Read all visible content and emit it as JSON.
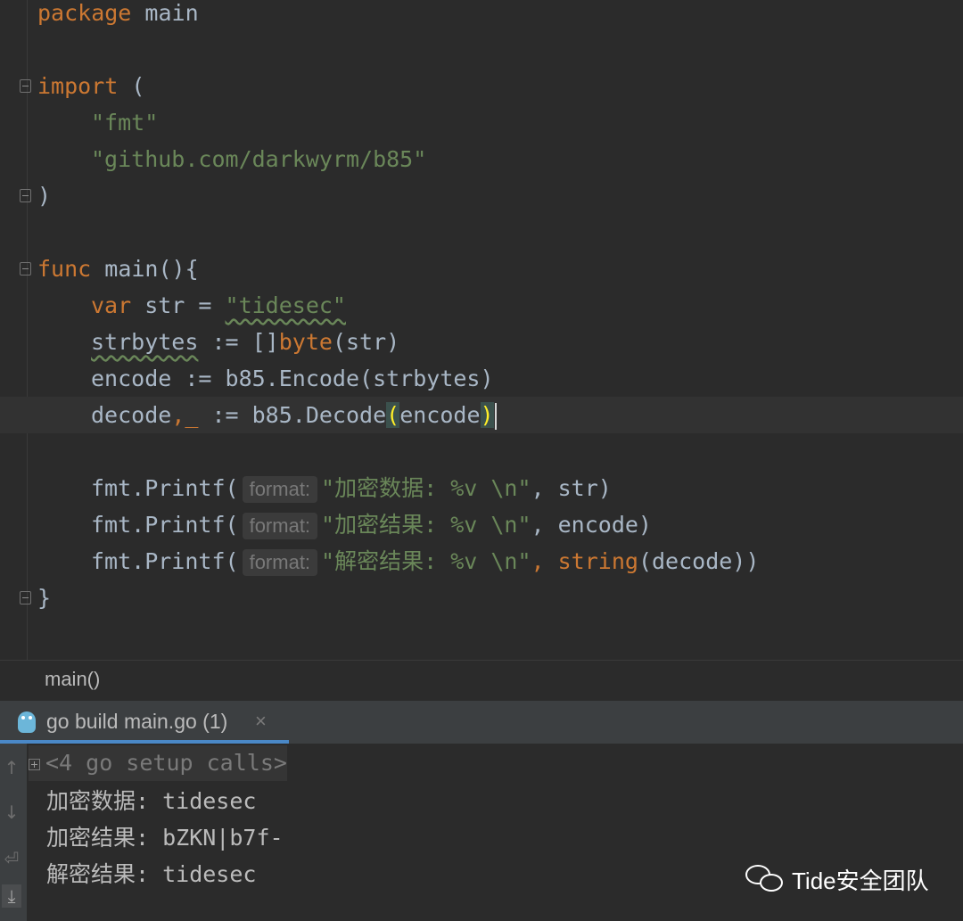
{
  "editor": {
    "lines": {
      "l1": {
        "kw": "package",
        "rest": " main"
      },
      "l2": {
        "kw": "import",
        "rest": " ("
      },
      "l3": {
        "str": "\"fmt\""
      },
      "l4": {
        "str": "\"github.com/darkwyrm/b85\""
      },
      "l5": {
        "text": ")"
      },
      "l6": {
        "kw": "func",
        "rest": " main(){"
      },
      "l7": {
        "kw": "var",
        "mid": " str = ",
        "str": "\"tidesec\""
      },
      "l8": {
        "ident": "strbytes",
        "mid": " := []",
        "type": "byte",
        "rest": "(str)"
      },
      "l9": {
        "text": "encode := b85.Encode(strbytes)"
      },
      "l10": {
        "pre": "decode",
        "punct": ",_",
        "mid": " := b85.Decode",
        "open": "(",
        "arg": "encode",
        "close": ")"
      },
      "l11": {
        "pre": "fmt.Printf(",
        "hint": "format:",
        "str": "\"加密数据: %v \\n\"",
        "rest": ", str)"
      },
      "l12": {
        "pre": "fmt.Printf(",
        "hint": "format:",
        "str": "\"加密结果: %v \\n\"",
        "rest": ", encode)"
      },
      "l13": {
        "pre": "fmt.Printf(",
        "hint": "format:",
        "str": "\"解密结果: %v \\n\"",
        "fn": ", string",
        "rest": "(decode))"
      },
      "l14": {
        "text": "}"
      }
    }
  },
  "breadcrumb": {
    "label": "main()"
  },
  "run_panel": {
    "tab_label": "go build main.go (1)",
    "close_glyph": "×",
    "setup_calls": "<4 go setup calls>",
    "output": [
      "加密数据: tidesec",
      "加密结果: bZKN|b7f-",
      "解密结果: tidesec"
    ]
  },
  "watermark": {
    "text": "Tide安全团队"
  }
}
